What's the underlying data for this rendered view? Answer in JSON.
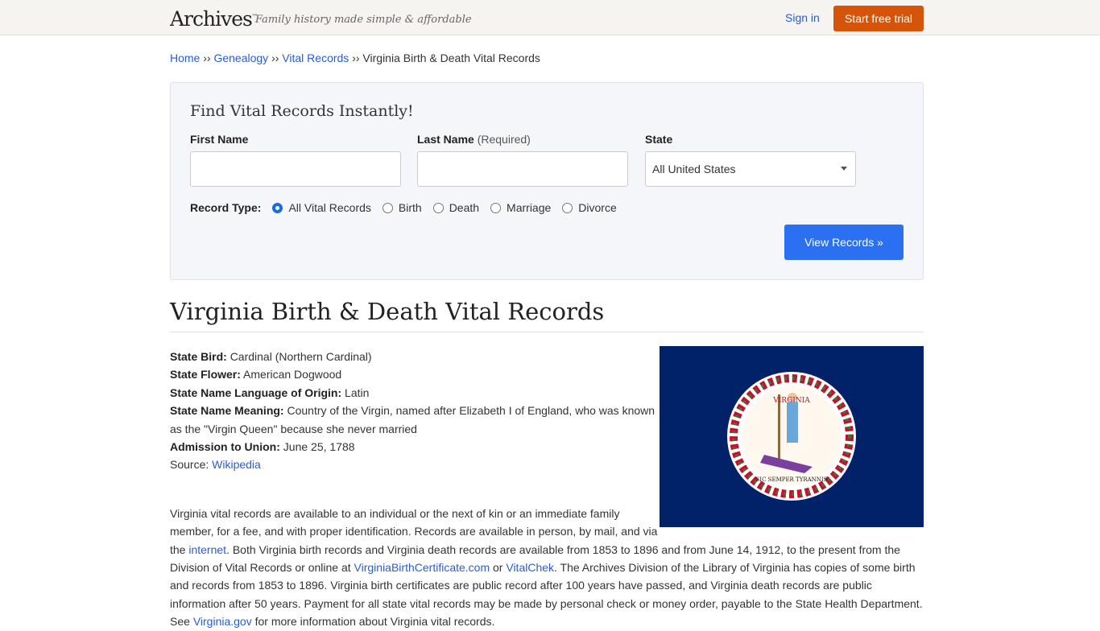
{
  "header": {
    "logo": "Archives",
    "logo_mark": "™",
    "tagline": "Family history made simple & affordable",
    "sign_in": "Sign in",
    "trial": "Start free trial"
  },
  "breadcrumb": {
    "items": [
      "Home",
      "Genealogy",
      "Vital Records"
    ],
    "sep": " ›› ",
    "current": "Virginia Birth & Death Vital Records"
  },
  "search": {
    "title": "Find Vital Records Instantly!",
    "first_name": "First Name",
    "last_name": "Last Name",
    "last_name_note": "(Required)",
    "state": "State",
    "state_value": "All United States",
    "record_type": "Record Type:",
    "options": [
      "All Vital Records",
      "Birth",
      "Death",
      "Marriage",
      "Divorce"
    ],
    "selected": 0,
    "button": "View Records »"
  },
  "page": {
    "title": "Virginia Birth & Death Vital Records",
    "facts": [
      {
        "k": "State Bird:",
        "v": "Cardinal (Northern Cardinal)"
      },
      {
        "k": "State Flower:",
        "v": "American Dogwood"
      },
      {
        "k": "State Name Language of Origin:",
        "v": "Latin"
      },
      {
        "k": "State Name Meaning:",
        "v": "Country of the Virgin, named after Elizabeth I of England, who was known as the \"Virgin Queen\" because she never married"
      },
      {
        "k": "Admission to Union:",
        "v": "June 25, 1788"
      }
    ],
    "source_label": "Source:",
    "source_link": "Wikipedia",
    "flag_text": "VIRGINIA",
    "flag_motto": "SIC SEMPER TYRANNIS",
    "flag_color": "#012169",
    "p1": "Virginia vital records are available to an individual or the next of kin or an immediate family member, for a fee, and with proper identification. Records are available in person, by mail, and via the ",
    "l1": "internet",
    "p2": ". Both Virginia birth records and Virginia death records are available from 1853 to 1896 and from June 14, 1912, to the present from the Division of Vital Records or online at ",
    "l2": "VirginiaBirthCertificate.com",
    "p3": " or ",
    "l3": "VitalChek",
    "p4": ". The Archives Division of the Library of Virginia has copies of some birth and records from 1853 to 1896. Virginia birth certificates are public record after 100 years have passed, and Virginia death records are public information after 50 years. Payment for all state vital records may be made by personal check or money order, payable to the State Health Department. See ",
    "l4": "Virginia.gov",
    "p5": " for more information about Virginia vital records."
  }
}
